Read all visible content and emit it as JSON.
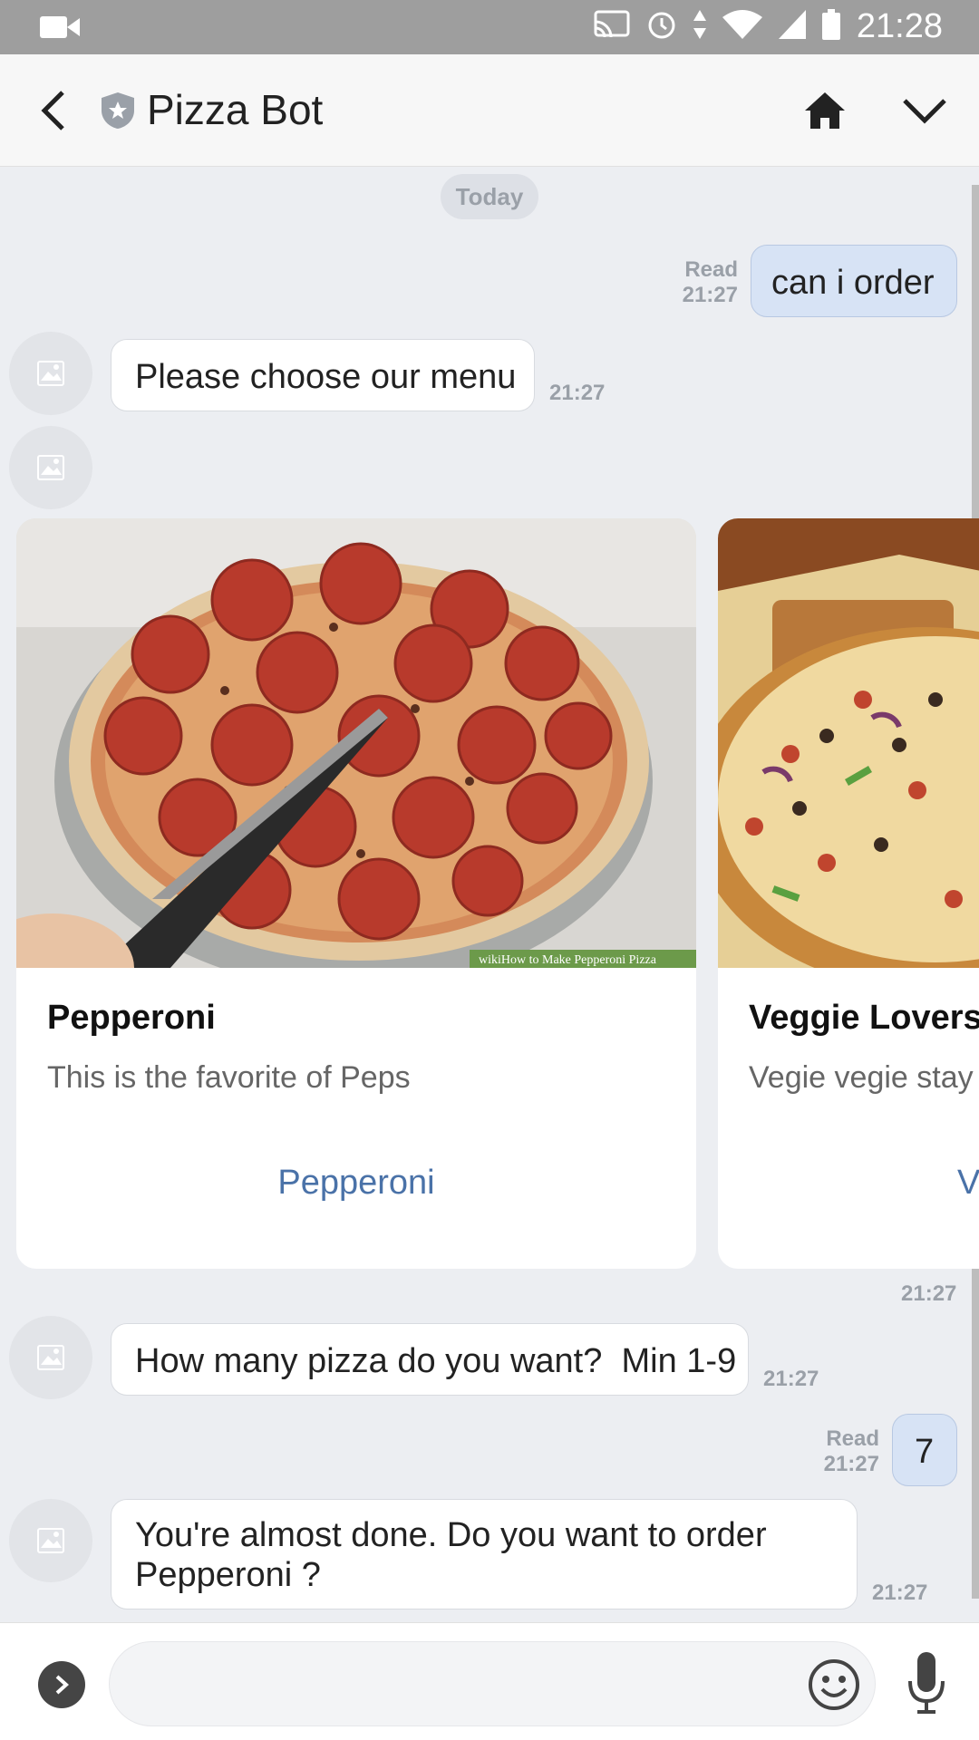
{
  "status_bar": {
    "time": "21:28"
  },
  "header": {
    "title": "Pizza Bot"
  },
  "chat": {
    "date_separator": "Today",
    "messages": [
      {
        "from": "user",
        "text": "can i order",
        "read_label": "Read",
        "time": "21:27"
      },
      {
        "from": "bot",
        "text": "Please choose our menu",
        "time": "21:27"
      },
      {
        "from": "bot",
        "type": "carousel",
        "time": "21:27"
      },
      {
        "from": "bot",
        "text": "How many pizza do you want?  Min 1-9",
        "time": "21:27"
      },
      {
        "from": "user",
        "text": "7",
        "read_label": "Read",
        "time": "21:27"
      },
      {
        "from": "bot",
        "text_line1": "You're almost done. Do you want to order",
        "text_line2": "Pepperoni ?",
        "time": "21:27"
      }
    ],
    "carousel": [
      {
        "title": "Pepperoni",
        "description": "This is the favorite of Peps",
        "action": "Pepperoni",
        "image_caption": "wikiHow to Make Pepperoni Pizza"
      },
      {
        "title": "Veggie Lovers",
        "description": "Vegie vegie stay",
        "action": "V"
      }
    ]
  },
  "input": {
    "placeholder": ""
  },
  "icons": [
    "video-icon",
    "cast-icon",
    "alarm-icon",
    "wifi-icon",
    "signal-icon",
    "battery-icon",
    "back-arrow-icon",
    "bot-shield-icon",
    "home-icon",
    "chevron-down-icon",
    "image-placeholder-icon",
    "expand-arrow-icon",
    "emoji-icon",
    "microphone-icon"
  ],
  "colors": {
    "user_bubble": "#d7e3f5",
    "link": "#4a72a8",
    "status_bar": "#9e9e9e"
  }
}
